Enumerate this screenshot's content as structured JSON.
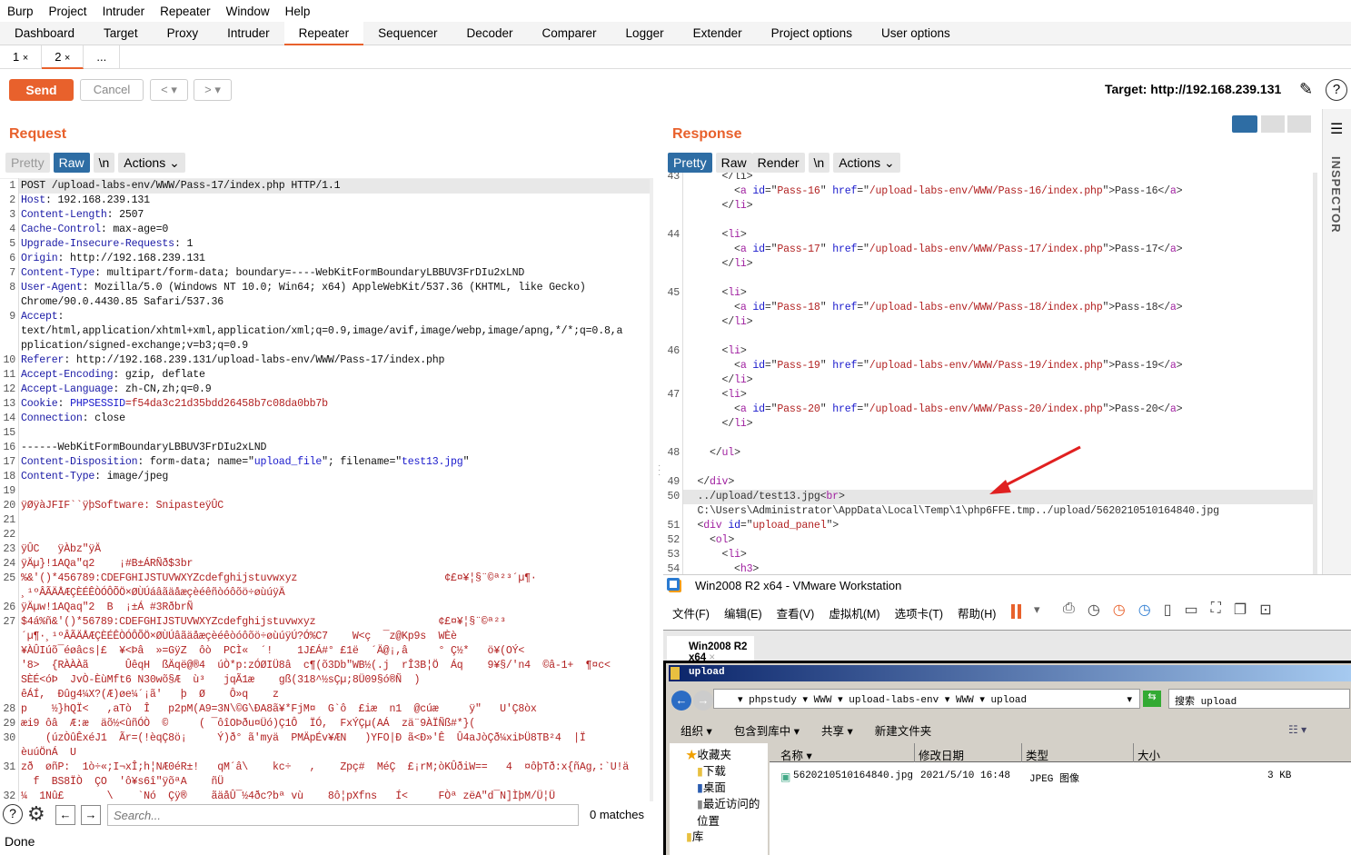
{
  "menu": [
    "Burp",
    "Project",
    "Intruder",
    "Repeater",
    "Window",
    "Help"
  ],
  "tabs": [
    "Dashboard",
    "Target",
    "Proxy",
    "Intruder",
    "Repeater",
    "Sequencer",
    "Decoder",
    "Comparer",
    "Logger",
    "Extender",
    "Project options",
    "User options"
  ],
  "active_tab": "Repeater",
  "subtabs": [
    {
      "label": "1",
      "close": "×"
    },
    {
      "label": "2",
      "close": "×"
    },
    {
      "label": "..."
    }
  ],
  "toolbar": {
    "send": "Send",
    "cancel": "Cancel",
    "back": "<",
    "fwd": ">",
    "dropdown": "▾",
    "target": "Target: http://192.168.239.131"
  },
  "request": {
    "title": "Request",
    "views": [
      "Pretty",
      "Raw",
      "\\n",
      "Actions"
    ],
    "active_view": "Raw",
    "lines": [
      {
        "n": "1",
        "t": [
          [
            "POST /upload-labs-env/WWW/Pass-17/index.php HTTP/1.1",
            "v"
          ]
        ]
      },
      {
        "n": "2",
        "t": [
          [
            "Host",
            "k"
          ],
          [
            ": 192.168.239.131",
            "v"
          ]
        ]
      },
      {
        "n": "3",
        "t": [
          [
            "Content-Length",
            "k"
          ],
          [
            ": 2507",
            "v"
          ]
        ]
      },
      {
        "n": "4",
        "t": [
          [
            "Cache-Control",
            "k"
          ],
          [
            ": max-age=0",
            "v"
          ]
        ]
      },
      {
        "n": "5",
        "t": [
          [
            "Upgrade-Insecure-Requests",
            "k"
          ],
          [
            ": 1",
            "v"
          ]
        ]
      },
      {
        "n": "6",
        "t": [
          [
            "Origin",
            "k"
          ],
          [
            ": http://192.168.239.131",
            "v"
          ]
        ]
      },
      {
        "n": "7",
        "t": [
          [
            "Content-Type",
            "k"
          ],
          [
            ": multipart/form-data; boundary=----WebKitFormBoundaryLBBUV3FrDIu2xLND",
            "v"
          ]
        ]
      },
      {
        "n": "8",
        "t": [
          [
            "User-Agent",
            "k"
          ],
          [
            ": Mozilla/5.0 (Windows NT 10.0; Win64; x64) AppleWebKit/537.36 (KHTML, like Gecko)",
            "v"
          ]
        ]
      },
      {
        "n": "",
        "t": [
          [
            "Chrome/90.0.4430.85 Safari/537.36",
            "v"
          ]
        ]
      },
      {
        "n": "9",
        "t": [
          [
            "Accept",
            "k"
          ],
          [
            ":",
            "v"
          ]
        ]
      },
      {
        "n": "",
        "t": [
          [
            "text/html,application/xhtml+xml,application/xml;q=0.9,image/avif,image/webp,image/apng,*/*;q=0.8,a",
            "v"
          ]
        ]
      },
      {
        "n": "",
        "t": [
          [
            "pplication/signed-exchange;v=b3;q=0.9",
            "v"
          ]
        ]
      },
      {
        "n": "10",
        "t": [
          [
            "Referer",
            "k"
          ],
          [
            ": http://192.168.239.131/upload-labs-env/WWW/Pass-17/index.php",
            "v"
          ]
        ]
      },
      {
        "n": "11",
        "t": [
          [
            "Accept-Encoding",
            "k"
          ],
          [
            ": gzip, deflate",
            "v"
          ]
        ]
      },
      {
        "n": "12",
        "t": [
          [
            "Accept-Language",
            "k"
          ],
          [
            ": zh-CN,zh;q=0.9",
            "v"
          ]
        ]
      },
      {
        "n": "13",
        "t": [
          [
            "Cookie",
            "k"
          ],
          [
            ": ",
            "v"
          ],
          [
            "PHPSESSID",
            "b"
          ],
          [
            "=f54da3c21d35bdd26458b7c08da0bb7b",
            "r"
          ]
        ]
      },
      {
        "n": "14",
        "t": [
          [
            "Connection",
            "k"
          ],
          [
            ": close",
            "v"
          ]
        ]
      },
      {
        "n": "15",
        "t": []
      },
      {
        "n": "16",
        "t": [
          [
            "------WebKitFormBoundaryLBBUV3FrDIu2xLND",
            "v"
          ]
        ]
      },
      {
        "n": "17",
        "t": [
          [
            "Content-Disposition",
            "k"
          ],
          [
            ": form-data; name=\"",
            "v"
          ],
          [
            "upload_file",
            "b"
          ],
          [
            "\"; filename=\"",
            "v"
          ],
          [
            "test13.jpg",
            "b"
          ],
          [
            "\"",
            "v"
          ]
        ]
      },
      {
        "n": "18",
        "t": [
          [
            "Content-Type",
            "k"
          ],
          [
            ": image/jpeg",
            "v"
          ]
        ]
      },
      {
        "n": "19",
        "t": []
      },
      {
        "n": "20",
        "t": [
          [
            "ÿØÿàJFIF``ÿþSoftware: SnipasteÿÛC",
            "r"
          ]
        ]
      },
      {
        "n": "21",
        "t": []
      },
      {
        "n": "22",
        "t": []
      },
      {
        "n": "23",
        "t": [
          [
            "ÿÛC   ÿÀbz\"ÿÄ",
            "r"
          ]
        ]
      },
      {
        "n": "24",
        "t": [
          [
            "ÿÄµ}!1AQa\"q2    ¡#B±ÁRÑð$3br",
            "r"
          ]
        ]
      },
      {
        "n": "25",
        "t": [
          [
            "%&'()*456789:CDEFGHIJSTUVWXYZcdefghijstuvwxyz                        ¢£¤¥¦§¨©ª²³´µ¶·",
            "r"
          ]
        ]
      },
      {
        "n": "",
        "t": [
          [
            "¸¹ºÂÃÄÅÆÇÈÉÊÒÓÔÕÖ×ØÙÚáâãäåæçèéêñòóôõö÷øùúÿÄ",
            "r"
          ]
        ]
      },
      {
        "n": "26",
        "t": [
          [
            "ÿÄµw!1AQaq\"2  B  ¡±Á #3RðbrÑ",
            "r"
          ]
        ]
      },
      {
        "n": "27",
        "t": [
          [
            "$4á%ñ&'()*56789:CDEFGHIJSTUVWXYZcdefghijstuvwxyz                    ¢£¤¥¦§¨©ª²³",
            "r"
          ]
        ]
      },
      {
        "n": "",
        "t": [
          [
            "´µ¶·¸¹ºÂÃÄÅÆÇÈÉÊÒÓÔÕÖ×ØÙÚâãäåæçèéêòóôõö÷øùúÿÚ?Ó%C7    W<ç  ¯z@Kp9s  WÈè",
            "r"
          ]
        ]
      },
      {
        "n": "",
        "t": [
          [
            "¥ÀÛIúõ¯éøâcs|£  ¥<Þâ  »=GÿZ  ôò  PCÌ«  ´!    1J£Á#° £1ë  ´Ä@¡,â     ° Ç½*   ö¥(OÝ<",
            "r"
          ]
        ]
      },
      {
        "n": "",
        "t": [
          [
            "'8>  {RÀÀÀã      ÛêqH  ßÄqë@®4  úÒ*p:zÓØIÜ8â  c¶(õ3Db\"WB½(.j  rÎ3B¦Ö  Áq    9¥§/'n4  ©â-1+  ¶¤c<",
            "r"
          ]
        ]
      },
      {
        "n": "",
        "t": [
          [
            "SÈÉ<óÞ  JvÒ-ÈùMft6 N30wõ§Æ  ù³   jqÃ1æ    gß(318^½sÇµ;8Ü09§ó®Ñ  )",
            "r"
          ]
        ]
      },
      {
        "n": "",
        "t": [
          [
            "êÁÍ,  Ðûg4¼X?(Æ)øe¼´¡ã'   þ  Ø    Ô»q    z",
            "r"
          ]
        ]
      },
      {
        "n": "28",
        "t": [
          [
            "p    ½}hQÏ<   ,aTò  Î   p2pM(A9=3N\\©G\\ÐA8ã¥*FjM¤  G`ô  £iæ  n1  @cúæ     ÿ\"   U'Ç8òx",
            "r"
          ]
        ]
      },
      {
        "n": "29",
        "t": [
          [
            "æi9 ôâ  Æ:æ  äõ½<ûñÓÒ  ©     ( ¯ôîOÞðu¤Üó)Ç1Ô  ÏÓ,  FxÝÇµ(AÁ  zä¨9ÀÏÑß#*}(",
            "r"
          ]
        ]
      },
      {
        "n": "30",
        "t": [
          [
            "    (úzÒûÊxéJ1  Ãr=(!èqÇ8ö¡     Ý)ð° ã'myä  PMÄpÉv¥ÆN   )YFO|Ð ã<Ð»'Ê  Û4aJòÇð¼xiÞÜ8TB²4  |Ï",
            "r"
          ]
        ]
      },
      {
        "n": "",
        "t": [
          [
            "èuúÖnÁ  U",
            "r"
          ]
        ]
      },
      {
        "n": "31",
        "t": [
          [
            "zð  øñP:  1ò÷«;I¬xÎ;h¦NÆ0éR±!   qM´â\\    kc÷   ,    Zpç#  MéÇ  £¡rM;òKÛðiW==   4  ¤ôþTð:x{ñAg,:`U!ä",
            "r"
          ]
        ]
      },
      {
        "n": "",
        "t": [
          [
            "  f  BS8ÏÒ  ÇO  'ô¥s6î\"ÿõªA    ñÜ",
            "r"
          ]
        ]
      },
      {
        "n": "32",
        "t": [
          [
            "¼  1Nû£       \\    `Nó  Çÿ®    ãäåÛ¯½4ðc?bª vù    8ô¦pXfns   Í<     FÒª zëA\"d¯N]ÌþM/Ü¦Ü",
            "r"
          ]
        ]
      }
    ]
  },
  "search": {
    "placeholder": "Search...",
    "matches": "0 matches"
  },
  "status": "Done",
  "response": {
    "title": "Response",
    "views": [
      "Pretty",
      "Raw",
      "Render",
      "\\n",
      "Actions"
    ],
    "active_view": "Pretty",
    "lines": [
      {
        "n": "43",
        "t": [
          [
            "      </li>",
            "t"
          ]
        ]
      },
      {
        "n": "",
        "t": [
          [
            "        <",
            "t"
          ],
          [
            "a",
            "g"
          ],
          [
            " id",
            "b"
          ],
          [
            "=\"",
            "t"
          ],
          [
            "Pass-16",
            "s"
          ],
          [
            "\" ",
            "t"
          ],
          [
            "href",
            "b"
          ],
          [
            "=\"",
            "t"
          ],
          [
            "/upload-labs-env/WWW/Pass-16/index.php",
            "s"
          ],
          [
            "\">Pass-16</",
            "t"
          ],
          [
            "a",
            "g"
          ],
          [
            ">",
            "t"
          ]
        ]
      },
      {
        "n": "",
        "t": [
          [
            "      </",
            "t"
          ],
          [
            "li",
            "g"
          ],
          [
            ">",
            "t"
          ]
        ]
      },
      {
        "n": "",
        "t": []
      },
      {
        "n": "44",
        "t": [
          [
            "      <",
            "t"
          ],
          [
            "li",
            "g"
          ],
          [
            ">",
            "t"
          ]
        ]
      },
      {
        "n": "",
        "t": [
          [
            "        <",
            "t"
          ],
          [
            "a",
            "g"
          ],
          [
            " id",
            "b"
          ],
          [
            "=\"",
            "t"
          ],
          [
            "Pass-17",
            "s"
          ],
          [
            "\" ",
            "t"
          ],
          [
            "href",
            "b"
          ],
          [
            "=\"",
            "t"
          ],
          [
            "/upload-labs-env/WWW/Pass-17/index.php",
            "s"
          ],
          [
            "\">Pass-17</",
            "t"
          ],
          [
            "a",
            "g"
          ],
          [
            ">",
            "t"
          ]
        ]
      },
      {
        "n": "",
        "t": [
          [
            "      </",
            "t"
          ],
          [
            "li",
            "g"
          ],
          [
            ">",
            "t"
          ]
        ]
      },
      {
        "n": "",
        "t": []
      },
      {
        "n": "45",
        "t": [
          [
            "      <",
            "t"
          ],
          [
            "li",
            "g"
          ],
          [
            ">",
            "t"
          ]
        ]
      },
      {
        "n": "",
        "t": [
          [
            "        <",
            "t"
          ],
          [
            "a",
            "g"
          ],
          [
            " id",
            "b"
          ],
          [
            "=\"",
            "t"
          ],
          [
            "Pass-18",
            "s"
          ],
          [
            "\" ",
            "t"
          ],
          [
            "href",
            "b"
          ],
          [
            "=\"",
            "t"
          ],
          [
            "/upload-labs-env/WWW/Pass-18/index.php",
            "s"
          ],
          [
            "\">Pass-18</",
            "t"
          ],
          [
            "a",
            "g"
          ],
          [
            ">",
            "t"
          ]
        ]
      },
      {
        "n": "",
        "t": [
          [
            "      </",
            "t"
          ],
          [
            "li",
            "g"
          ],
          [
            ">",
            "t"
          ]
        ]
      },
      {
        "n": "",
        "t": []
      },
      {
        "n": "46",
        "t": [
          [
            "      <",
            "t"
          ],
          [
            "li",
            "g"
          ],
          [
            ">",
            "t"
          ]
        ]
      },
      {
        "n": "",
        "t": [
          [
            "        <",
            "t"
          ],
          [
            "a",
            "g"
          ],
          [
            " id",
            "b"
          ],
          [
            "=\"",
            "t"
          ],
          [
            "Pass-19",
            "s"
          ],
          [
            "\" ",
            "t"
          ],
          [
            "href",
            "b"
          ],
          [
            "=\"",
            "t"
          ],
          [
            "/upload-labs-env/WWW/Pass-19/index.php",
            "s"
          ],
          [
            "\">Pass-19</",
            "t"
          ],
          [
            "a",
            "g"
          ],
          [
            ">",
            "t"
          ]
        ]
      },
      {
        "n": "",
        "t": [
          [
            "      </",
            "t"
          ],
          [
            "li",
            "g"
          ],
          [
            ">",
            "t"
          ]
        ]
      },
      {
        "n": "47",
        "t": [
          [
            "      <",
            "t"
          ],
          [
            "li",
            "g"
          ],
          [
            ">",
            "t"
          ]
        ]
      },
      {
        "n": "",
        "t": [
          [
            "        <",
            "t"
          ],
          [
            "a",
            "g"
          ],
          [
            " id",
            "b"
          ],
          [
            "=\"",
            "t"
          ],
          [
            "Pass-20",
            "s"
          ],
          [
            "\" ",
            "t"
          ],
          [
            "href",
            "b"
          ],
          [
            "=\"",
            "t"
          ],
          [
            "/upload-labs-env/WWW/Pass-20/index.php",
            "s"
          ],
          [
            "\">Pass-20</",
            "t"
          ],
          [
            "a",
            "g"
          ],
          [
            ">",
            "t"
          ]
        ]
      },
      {
        "n": "",
        "t": [
          [
            "      </",
            "t"
          ],
          [
            "li",
            "g"
          ],
          [
            ">",
            "t"
          ]
        ]
      },
      {
        "n": "",
        "t": []
      },
      {
        "n": "48",
        "t": [
          [
            "    </",
            "t"
          ],
          [
            "ul",
            "g"
          ],
          [
            ">",
            "t"
          ]
        ]
      },
      {
        "n": "",
        "t": []
      },
      {
        "n": "49",
        "t": [
          [
            "  </",
            "t"
          ],
          [
            "div",
            "g"
          ],
          [
            ">",
            "t"
          ]
        ]
      },
      {
        "n": "50",
        "t": [
          [
            "  ../upload/test13.jpg<",
            "t"
          ],
          [
            "br",
            "g"
          ],
          [
            ">",
            "t"
          ]
        ],
        "hl": true
      },
      {
        "n": "",
        "t": [
          [
            "  C:\\Users\\Administrator\\AppData\\Local\\Temp\\1\\php6FFE.tmp../upload/5620210510164840.jpg",
            "t"
          ]
        ]
      },
      {
        "n": "51",
        "t": [
          [
            "  <",
            "t"
          ],
          [
            "div",
            "g"
          ],
          [
            " id",
            "b"
          ],
          [
            "=\"",
            "t"
          ],
          [
            "upload_panel",
            "s"
          ],
          [
            "\">",
            "t"
          ]
        ]
      },
      {
        "n": "52",
        "t": [
          [
            "    <",
            "t"
          ],
          [
            "ol",
            "g"
          ],
          [
            ">",
            "t"
          ]
        ]
      },
      {
        "n": "53",
        "t": [
          [
            "      <",
            "t"
          ],
          [
            "li",
            "g"
          ],
          [
            ">",
            "t"
          ]
        ]
      },
      {
        "n": "54",
        "t": [
          [
            "        <",
            "t"
          ],
          [
            "h3",
            "g"
          ],
          [
            ">",
            "t"
          ]
        ]
      }
    ]
  },
  "inspector": "INSPECTOR",
  "vmware": {
    "title": "Win2008 R2 x64 - VMware Workstation",
    "menu": [
      "文件(F)",
      "编辑(E)",
      "查看(V)",
      "虚拟机(M)",
      "选项卡(T)",
      "帮助(H)"
    ],
    "tab": "Win2008 R2 x64",
    "explorer": {
      "title": "upload",
      "path": [
        "phpstudy",
        "WWW",
        "upload-labs-env",
        "WWW",
        "upload"
      ],
      "search": "搜索 upload",
      "toolbar": [
        "组织",
        "包含到库中",
        "共享",
        "新建文件夹"
      ],
      "nav": [
        "收藏夹",
        "下载",
        "桌面",
        "最近访问的位置",
        "库"
      ],
      "columns": [
        "名称",
        "修改日期",
        "类型",
        "大小"
      ],
      "files": [
        {
          "name": "5620210510164840.jpg",
          "date": "2021/5/10 16:48",
          "type": "JPEG 图像",
          "size": "3 KB"
        }
      ]
    }
  },
  "colors": {
    "accent": "#e8612c",
    "view_active": "#2e6da4",
    "arrow": "#e02020"
  }
}
